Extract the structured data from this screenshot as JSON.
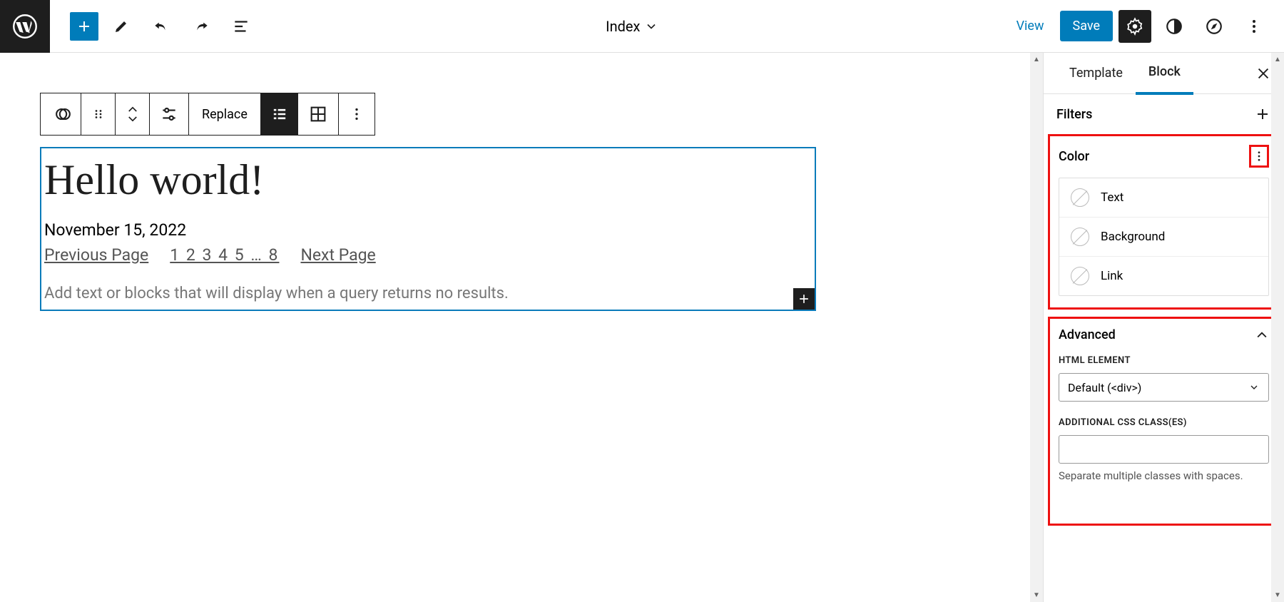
{
  "header": {
    "document_title": "Index",
    "view": "View",
    "save": "Save"
  },
  "toolbar": {
    "replace": "Replace"
  },
  "post": {
    "title": "Hello world!",
    "date": "November 15, 2022",
    "prev": "Previous Page",
    "pages": "1 2 3 4 5 … 8",
    "next": "Next Page",
    "no_results_placeholder": "Add text or blocks that will display when a query returns no results."
  },
  "sidebar": {
    "tabs": {
      "template": "Template",
      "block": "Block"
    },
    "filters": "Filters",
    "color": {
      "heading": "Color",
      "text": "Text",
      "background": "Background",
      "link": "Link"
    },
    "advanced": {
      "heading": "Advanced",
      "html_element_label": "HTML ELEMENT",
      "html_element_value": "Default (<div>)",
      "css_label": "ADDITIONAL CSS CLASS(ES)",
      "css_help": "Separate multiple classes with spaces."
    }
  }
}
